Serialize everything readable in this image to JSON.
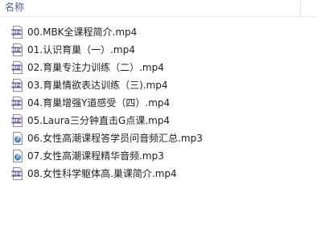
{
  "header": {
    "name_column_label": "名称"
  },
  "files": [
    {
      "name": "00.MBK全课程简介.mp4",
      "type": "mp4"
    },
    {
      "name": "01.认识育巢（一）.mp4",
      "type": "mp4"
    },
    {
      "name": "02.育巢专注力训练（二）.mp4",
      "type": "mp4"
    },
    {
      "name": "03.育巢情欲表达训练（三).mp4",
      "type": "mp4"
    },
    {
      "name": "04.育巢增强Y道感受（四）.mp4",
      "type": "mp4"
    },
    {
      "name": "05.Laura三分钟直击G点课.mp4",
      "type": "mp4"
    },
    {
      "name": "06.女性高潮课程答学员问音频汇总.mp3",
      "type": "mp3"
    },
    {
      "name": "07.女性高潮课程精华音频.mp3",
      "type": "mp3"
    },
    {
      "name": "08.女性科学躯体高.巢课简介.mp4",
      "type": "mp4"
    }
  ],
  "icons": {
    "mp4": "video-file-icon",
    "mp3": "audio-file-icon"
  },
  "colors": {
    "video_icon_fill": "#6b5aa8",
    "audio_icon_fill": "#3a7cc4"
  }
}
